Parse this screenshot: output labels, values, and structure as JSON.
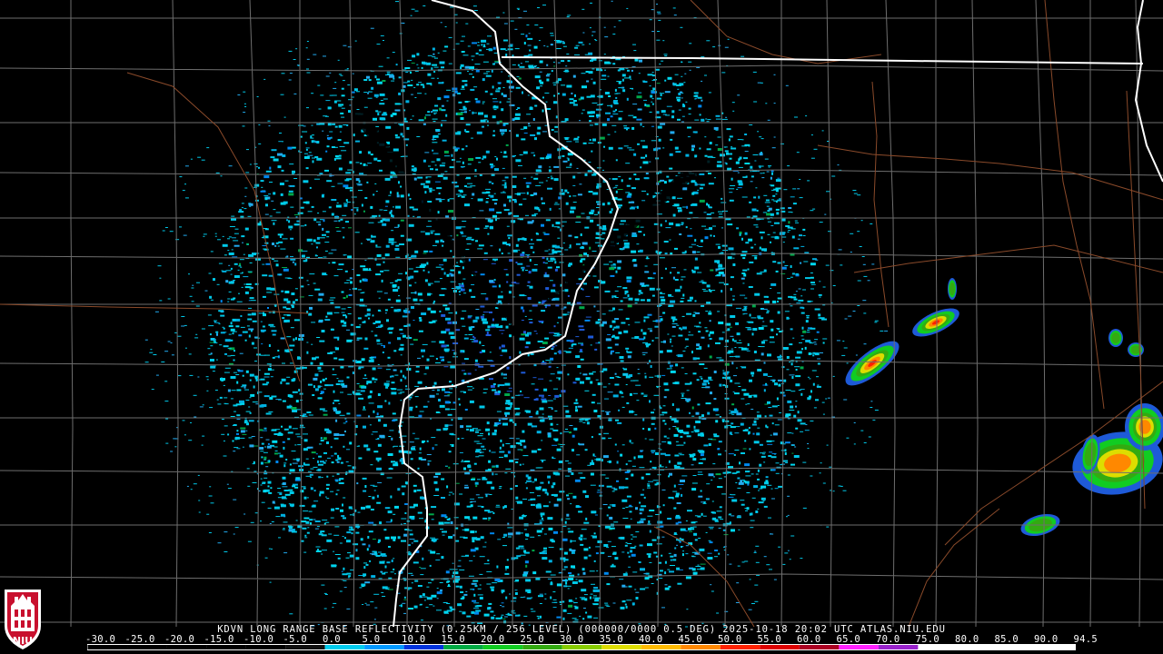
{
  "product": {
    "caption": "KDVN LONG RANGE BASE REFLECTIVITY (0.25KM / 256 LEVEL) (000000/0000 0.5 DEG) 2025-10-18 20:02 UTC  ATLAS.NIU.EDU"
  },
  "logo": {
    "text": "NIU"
  },
  "colors": {
    "background": "#000000",
    "county_lines": "#707070",
    "roads": "#8a4a2a",
    "state_lines": "#ffffff",
    "radar_site": "#000000"
  },
  "scale": {
    "labels": [
      "-30.0",
      "-25.0",
      "-20.0",
      "-15.0",
      "-10.0",
      "-5.0",
      "0.0",
      "5.0",
      "10.0",
      "15.0",
      "20.0",
      "25.0",
      "30.0",
      "35.0",
      "40.0",
      "45.0",
      "50.0",
      "55.0",
      "60.0",
      "65.0",
      "70.0",
      "75.0",
      "80.0",
      "85.0",
      "90.0",
      "94.5"
    ],
    "colors": [
      "#000000",
      "#000000",
      "#000000",
      "#000000",
      "#000000",
      "#101010",
      "#00ccee",
      "#0099ff",
      "#0033dd",
      "#00aa44",
      "#11cc22",
      "#33aa11",
      "#88cc00",
      "#dddd00",
      "#ffbb00",
      "#ff8800",
      "#ff2200",
      "#dd0000",
      "#aa0022",
      "#ff22ff",
      "#9922cc",
      "#ffffff",
      "#ffffff",
      "#ffffff",
      "#ffffff"
    ]
  }
}
